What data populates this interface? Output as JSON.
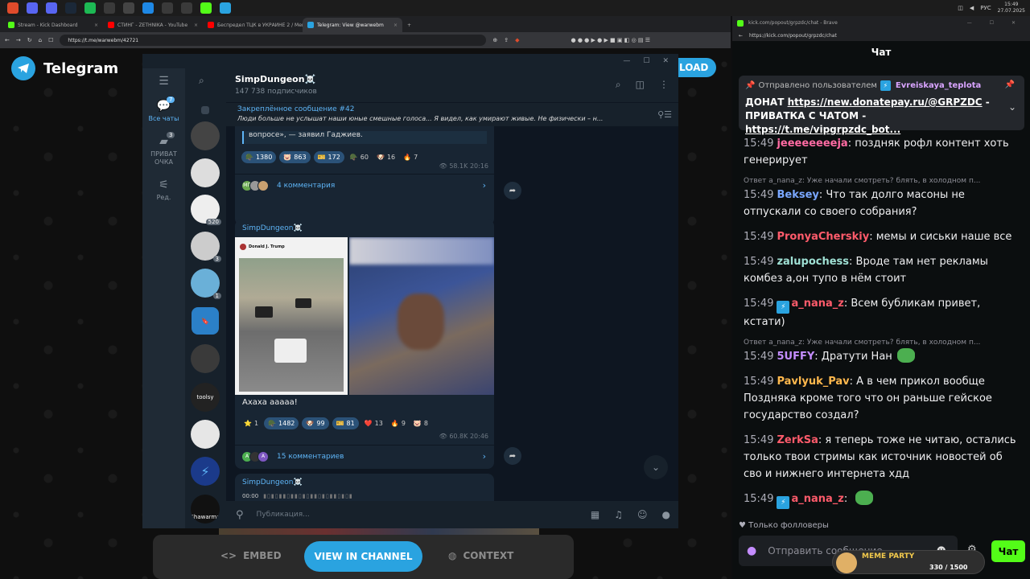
{
  "taskbar": {
    "icons": [
      {
        "name": "shield-icon",
        "color": "#e04b2b"
      },
      {
        "name": "record-icon",
        "color": "#5865f2"
      },
      {
        "name": "discord-icon",
        "color": "#5865f2"
      },
      {
        "name": "steam-icon",
        "color": "#1b2838"
      },
      {
        "name": "spotify-icon",
        "color": "#1db954"
      },
      {
        "name": "monitor-icon",
        "color": "#3a3a3a"
      },
      {
        "name": "xbox-icon",
        "color": "#444"
      },
      {
        "name": "p-icon",
        "color": "#1e88e5"
      },
      {
        "name": "folder-icon",
        "color": "#3a3a3a"
      },
      {
        "name": "terminal-icon",
        "color": "#3a3a3a"
      },
      {
        "name": "kick-icon",
        "color": "#53fc18"
      },
      {
        "name": "telegram-icon",
        "color": "#2aa3e0"
      }
    ],
    "lang": "РУС",
    "time": "15:49",
    "date": "27.07.2025"
  },
  "left_browser": {
    "tabs": [
      {
        "label": "Stream - Kick Dashboard",
        "color": "#53fc18"
      },
      {
        "label": "СТИНГ - ZETHNIKA - YouTube",
        "color": "#ff0000"
      },
      {
        "label": "Беспредел ТЦК в УКРАИНЕ 2 / Мем...",
        "color": "#ff0000"
      },
      {
        "label": "Telegram: View @warwebm",
        "color": "#2aa3e0"
      }
    ],
    "address": "https://t.me/warwebm/42721",
    "brand": "Telegram",
    "download_label": "LOAD"
  },
  "telegram": {
    "folders": [
      {
        "label": "Все чаты",
        "badge": "7",
        "icon": "chat-bubble-icon"
      },
      {
        "label": "ПРИВАТ ОЧКА",
        "badge": "3",
        "icon": "folder-icon"
      },
      {
        "label": "Ред.",
        "badge": "",
        "icon": "sliders-icon"
      }
    ],
    "chat_badges": [
      "",
      "",
      "520",
      "3",
      "1",
      "",
      "",
      "",
      "",
      ""
    ],
    "chat_labels": [
      "",
      "",
      "",
      "",
      "",
      "",
      "",
      "toolsy",
      "",
      "",
      "Shawarma"
    ],
    "channel_name": "SimpDungeon☠️",
    "subscribers": "147 738 подписчиков",
    "pinned_title": "Закреплённое сообщение #42",
    "pinned_text": "Люди больше не услышат наши юные смешные голоса...  Я видел, как умирают живые.   Не физически – н...",
    "post1": {
      "tail_text": "вопросе», — заявил Гаджиев.",
      "reactions": [
        {
          "icon": "🪖",
          "count": "1380",
          "filled": true
        },
        {
          "icon": "🐷",
          "count": "863",
          "filled": true
        },
        {
          "icon": "🎫",
          "count": "172",
          "filled": true
        },
        {
          "icon": "🪖",
          "count": "60",
          "filled": false
        },
        {
          "icon": "🐶",
          "count": "16",
          "filled": false
        },
        {
          "icon": "🔥",
          "count": "7",
          "filled": false
        }
      ],
      "views": "58.1K",
      "time": "20:16",
      "comments": "4 комментария"
    },
    "post2": {
      "author": "SimpDungeon☠️",
      "tweet_author": "Donald J. Trump",
      "caption": "Ахаха ааааа!",
      "reactions": [
        {
          "icon": "⭐",
          "count": "1",
          "filled": false
        },
        {
          "icon": "🪖",
          "count": "1482",
          "filled": true
        },
        {
          "icon": "🐶",
          "count": "99",
          "filled": true
        },
        {
          "icon": "🎫",
          "count": "81",
          "filled": true
        },
        {
          "icon": "❤️",
          "count": "13",
          "filled": false
        },
        {
          "icon": "🔥",
          "count": "9",
          "filled": false
        },
        {
          "icon": "🐷",
          "count": "8",
          "filled": false
        }
      ],
      "views": "60.8K",
      "time": "20:46",
      "comments": "15 комментариев"
    },
    "post3": {
      "author": "SimpDungeon☠️",
      "audio_time": "00:00"
    },
    "composer_placeholder": "Публикация..."
  },
  "bottom_bar": {
    "embed": "EMBED",
    "view": "VIEW IN CHANNEL",
    "context": "CONTEXT"
  },
  "right_browser": {
    "title": "kick.com/popout/grpzdc/chat - Brave",
    "address": "https://kick.com/popout/grpzdc/chat",
    "header": "Чат",
    "pinned": {
      "prefix": "Отправлено пользователем",
      "user": "Evreiskaya_teplota",
      "line1_text": "ДОНАТ ",
      "link1": "https://new.donatepay.ru/@GRPZDC",
      "line1_suffix": " -",
      "line2_text": "ПРИВАТКА С ЧАТОМ - ",
      "link2": "https://t.me/vipgrpzdc_bot..."
    },
    "messages": [
      {
        "reply": "",
        "time": "15:49",
        "user": "jeeeeeeeeja",
        "color": "#ff6ba3",
        "badge": false,
        "text": "поздняк рофл контент хоть генерирует",
        "emote": false
      },
      {
        "reply": "Ответ a_nana_z: Уже начали смотреть? блять, в холодном п...",
        "time": "15:49",
        "user": "Beksey",
        "color": "#7aa7ff",
        "badge": false,
        "text": "Что так долго масоны не отпускали со своего собрания?",
        "emote": false
      },
      {
        "reply": "",
        "time": "15:49",
        "user": "PronyaCherskiy",
        "color": "#ff5b6b",
        "badge": false,
        "text": "мемы и сиськи наше все",
        "emote": false
      },
      {
        "reply": "",
        "time": "15:49",
        "user": "zalupochess",
        "color": "#9fe0d4",
        "badge": false,
        "text": "Вроде там нет рекламы комбез а,он тупо в нём стоит",
        "emote": false
      },
      {
        "reply": "",
        "time": "15:49",
        "user": "a_nana_z",
        "color": "#ff5b6b",
        "badge": true,
        "text": "Всем бубликам привет, кстати)",
        "emote": false
      },
      {
        "reply": "Ответ a_nana_z: Уже начали смотреть? блять, в холодном п...",
        "time": "15:49",
        "user": "5UFFY",
        "color": "#c48dff",
        "badge": false,
        "text": "Дратути Нан",
        "emote": true
      },
      {
        "reply": "",
        "time": "15:49",
        "user": "Pavlyuk_Pav",
        "color": "#ffb84d",
        "badge": false,
        "text": "А в чем прикол вообще Поздняка кроме того что он раньше гейское государство создал?",
        "emote": false
      },
      {
        "reply": "",
        "time": "15:49",
        "user": "ZerkSa",
        "color": "#ff5b6b",
        "badge": false,
        "text": "я теперь тоже не читаю, остались только твои стримы как источник новостей об сво и нижнего интернета хдд",
        "emote": false
      },
      {
        "reply": "",
        "time": "15:49",
        "user": "a_nana_z",
        "color": "#ff5b6b",
        "badge": true,
        "text": "",
        "emote": true
      }
    ],
    "followers_only": "Только фолловеры",
    "send_placeholder": "Отправить сообщение",
    "send_button": "Чат",
    "meme_party": {
      "title": "MEME PARTY",
      "count": "330 / 1500"
    }
  }
}
